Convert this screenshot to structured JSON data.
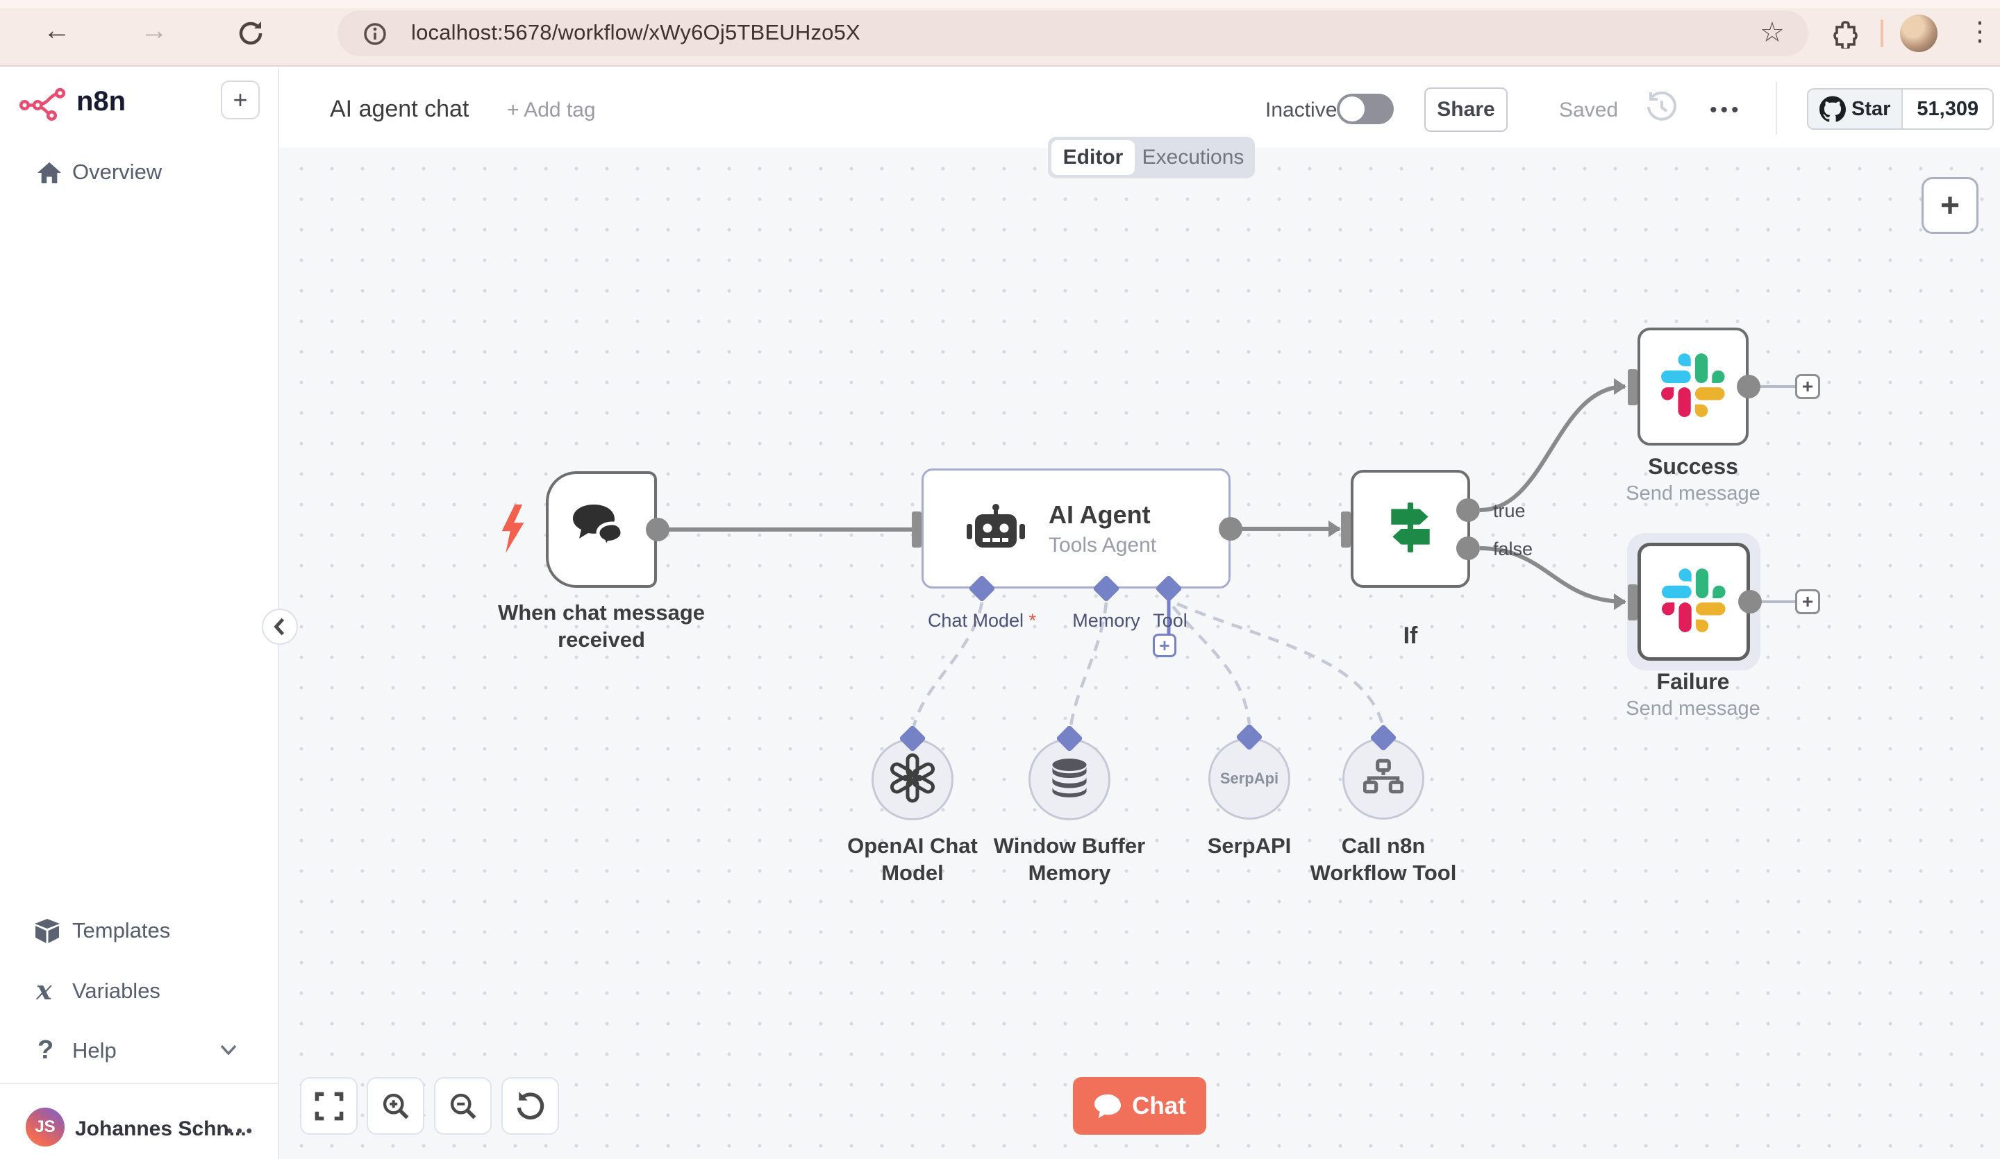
{
  "browser": {
    "url": "localhost:5678/workflow/xWy6Oj5TBEUHzo5X"
  },
  "icons": {
    "back": "←",
    "forward": "→",
    "bookmark": "☆",
    "plus": "+",
    "ellipsis": "•••",
    "kebab": "⋮",
    "variables": "x",
    "help": "?"
  },
  "sidebar": {
    "brand": "n8n",
    "overview": "Overview",
    "templates": "Templates",
    "variables": "Variables",
    "help": "Help",
    "user_initials": "JS",
    "user_name": "Johannes Schn..."
  },
  "header": {
    "title": "AI agent chat",
    "add_tag": "+ Add tag",
    "activation": "Inactive",
    "share": "Share",
    "save_status": "Saved",
    "github_star_label": "Star",
    "github_star_count": "51,309"
  },
  "tabs": {
    "editor": "Editor",
    "executions": "Executions"
  },
  "workflow": {
    "trigger_label": "When chat message received",
    "agent_title": "AI Agent",
    "agent_subtitle": "Tools Agent",
    "ports": {
      "chat_model": "Chat Model",
      "required": "*",
      "memory": "Memory",
      "tool": "Tool"
    },
    "if_label": "If",
    "if_true": "true",
    "if_false": "false",
    "success_label": "Success",
    "success_subtitle": "Send message",
    "failure_label": "Failure",
    "failure_subtitle": "Send message",
    "openai_label": "OpenAI Chat Model",
    "memory_label": "Window Buffer Memory",
    "serpapi_label": "SerpAPI",
    "serpapi_badge": "SerpApi",
    "n8n_tool_label": "Call n8n Workflow Tool"
  },
  "controls": {
    "chat": "Chat"
  },
  "colors": {
    "brand_accent": "#ea4b71",
    "chat_button": "#f0705a",
    "trigger_bolt": "#f4604e",
    "diamond_port": "#7682c6",
    "if_icon_green": "#1e8a47",
    "node_border": "#6e6e6e",
    "canvas_bg": "#f6f7f9",
    "chrome_bg": "#f7ebe7",
    "slack_blue": "#36C5F0",
    "slack_green": "#2EB67D",
    "slack_yellow": "#ECB22E",
    "slack_red": "#E01E5A"
  }
}
